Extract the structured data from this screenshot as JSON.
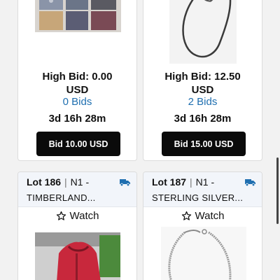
{
  "listings": [
    {
      "high_bid": "High Bid: 0.00",
      "currency": "USD",
      "bids": "0 Bids",
      "time_left": "3d 16h 28m",
      "bid_button": "Bid 10.00 USD"
    },
    {
      "high_bid": "High Bid: 12.50",
      "currency": "USD",
      "bids": "2 Bids",
      "time_left": "3d 16h 28m",
      "bid_button": "Bid 15.00 USD"
    },
    {
      "lot": "Lot 186",
      "category": "N1 -",
      "title": "TIMBERLAND...",
      "watch": "Watch",
      "shipping_icon": "truck-icon"
    },
    {
      "lot": "Lot 187",
      "category": "N1 -",
      "title": "STERLING SILVER...",
      "watch": "Watch",
      "shipping_icon": "truck-icon"
    }
  ],
  "colors": {
    "link_blue": "#1f6fb0",
    "button_black": "#0b0b0b",
    "truck_blue": "#1f6fb0"
  }
}
